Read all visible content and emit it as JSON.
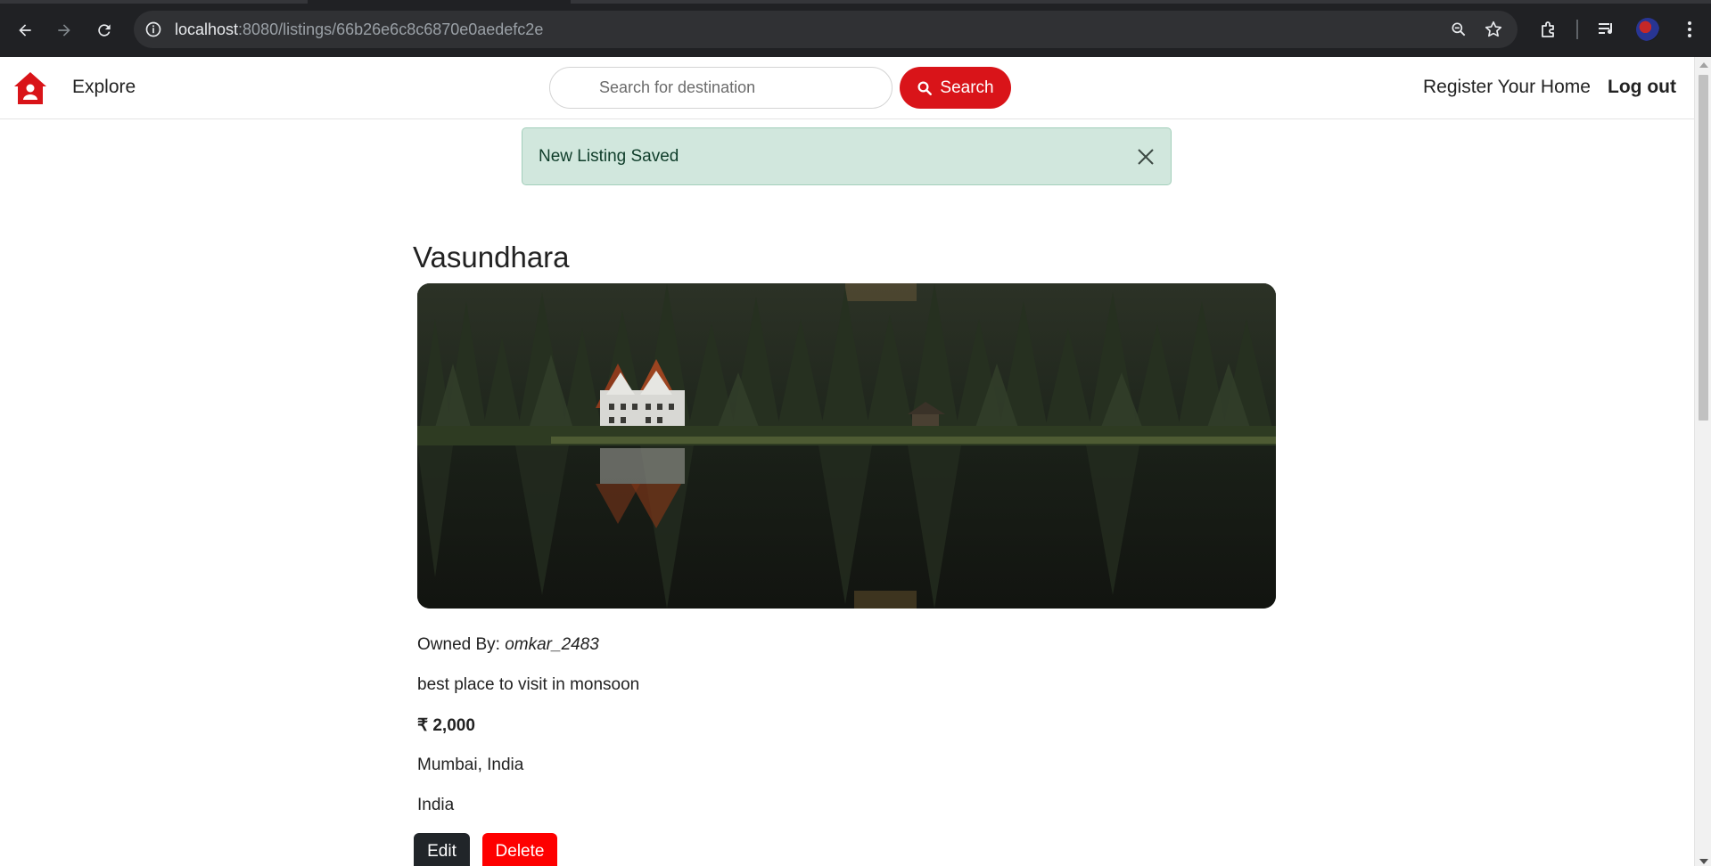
{
  "browser": {
    "url_host": "localhost",
    "url_path": ":8080/listings/66b26e6c8c6870e0aedefc2e"
  },
  "navbar": {
    "brand_icon": "house-user-icon",
    "explore_label": "Explore",
    "search_placeholder": "Search for destination",
    "search_button_label": "Search",
    "register_label": "Register Your Home",
    "logout_label": "Log out",
    "accent_color": "#d91419"
  },
  "alert": {
    "message": "New Listing Saved",
    "color": "#d1e7dd"
  },
  "listing": {
    "title": "Vasundhara",
    "image_alt": "Lakeside house among pine forest reflected in water",
    "owner_label": "Owned By:",
    "owner_name": "omkar_2483",
    "description": "best place to visit in monsoon",
    "price": "₹ 2,000",
    "location": "Mumbai, India",
    "country": "India",
    "edit_label": "Edit",
    "delete_label": "Delete",
    "delete_color": "#fe0000"
  }
}
